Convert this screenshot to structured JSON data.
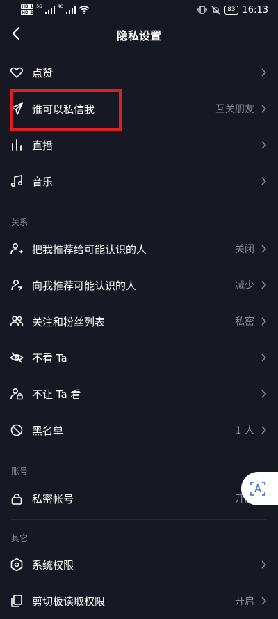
{
  "status_bar": {
    "hd1": "HD 1",
    "hd2": "HD 2",
    "net1": "5G",
    "net2": "4G",
    "battery": "83",
    "time": "16:13"
  },
  "nav": {
    "title": "隐私设置"
  },
  "rows_top": [
    {
      "label": "点赞",
      "value": "",
      "icon": "heart-icon"
    },
    {
      "label": "谁可以私信我",
      "value": "互关朋友",
      "icon": "send-icon"
    },
    {
      "label": "直播",
      "value": "",
      "icon": "live-bars-icon"
    },
    {
      "label": "音乐",
      "value": "",
      "icon": "music-note-icon"
    }
  ],
  "sections": {
    "relations": "关系",
    "account": "账号",
    "other": "其它"
  },
  "rows_relations": [
    {
      "label": "把我推荐给可能认识的人",
      "value": "关闭",
      "icon": "user-share-icon"
    },
    {
      "label": "向我推荐可能认识的人",
      "value": "减少",
      "icon": "user-recommend-icon"
    },
    {
      "label": "关注和粉丝列表",
      "value": "私密",
      "icon": "users-icon"
    },
    {
      "label": "不看 Ta",
      "value": "",
      "icon": "eye-off-icon"
    },
    {
      "label": "不让 Ta 看",
      "value": "",
      "icon": "user-lock-icon"
    },
    {
      "label": "黑名单",
      "value": "1 人",
      "icon": "block-icon"
    }
  ],
  "rows_account": [
    {
      "label": "私密帐号",
      "value": "开启",
      "icon": "lock-icon"
    }
  ],
  "rows_other": [
    {
      "label": "系统权限",
      "value": "",
      "icon": "hexagon-settings-icon"
    },
    {
      "label": "剪切板读取权限",
      "value": "开启",
      "icon": "clipboard-icon"
    }
  ],
  "colors": {
    "background": "#161823",
    "secondary_text": "#8a8b91",
    "highlight": "#e02020"
  }
}
